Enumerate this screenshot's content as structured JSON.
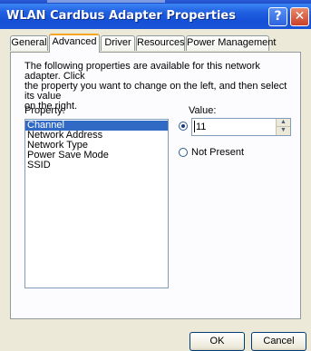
{
  "window": {
    "title": "WLAN Cardbus Adapter Properties",
    "help_button": "?",
    "close_button": "✕"
  },
  "tabs": [
    {
      "label": "General",
      "active": false
    },
    {
      "label": "Advanced",
      "active": true
    },
    {
      "label": "Driver",
      "active": false
    },
    {
      "label": "Resources",
      "active": false
    },
    {
      "label": "Power Management",
      "active": false
    }
  ],
  "panel": {
    "description_line1": "The following properties are available for this network adapter. Click",
    "description_line2": "the property you want to change on the left, and then select its value",
    "description_line3": "on the right.",
    "property_label": "Property:",
    "value_label": "Value:",
    "properties": [
      "Channel",
      "Network Address",
      "Network Type",
      "Power Save Mode",
      "SSID"
    ],
    "selected_property": "Channel",
    "value": "11",
    "not_present_label": "Not Present",
    "value_radio_selected": true
  },
  "buttons": {
    "ok": "OK",
    "cancel": "Cancel"
  },
  "colors": {
    "titlebar": "#1f5fe0",
    "selection": "#316ac5",
    "active_tab_accent": "#f5a623",
    "close_button": "#c9412a"
  }
}
